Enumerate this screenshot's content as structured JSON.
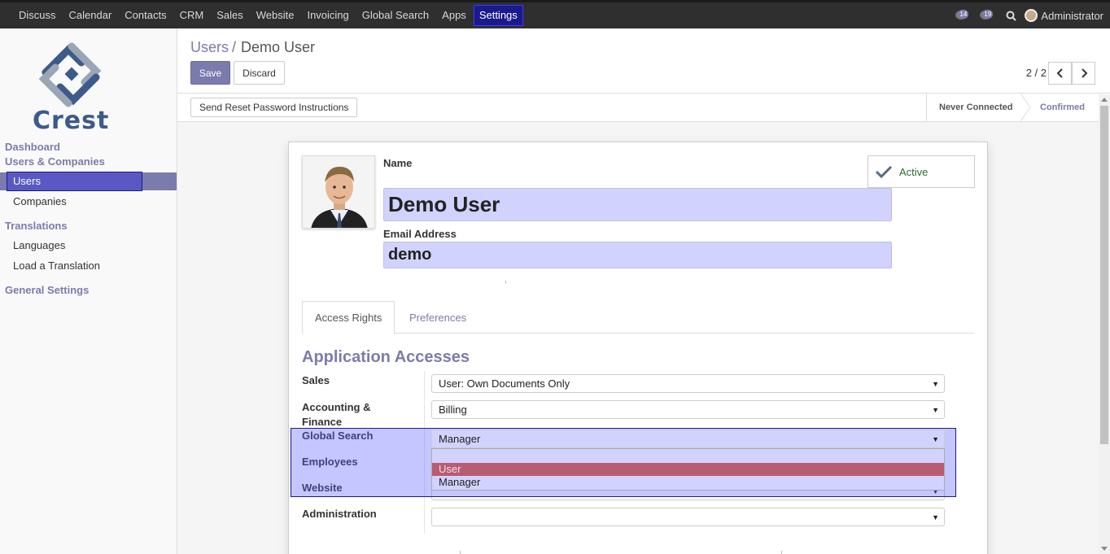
{
  "topbar": {
    "menu": [
      "Discuss",
      "Calendar",
      "Contacts",
      "CRM",
      "Sales",
      "Website",
      "Invoicing",
      "Global Search",
      "Apps",
      "Settings"
    ],
    "active_menu": "Settings",
    "messages_count": "14",
    "activities_count": "19",
    "user": "Administrator"
  },
  "sidebar": {
    "logo_text": "Crest",
    "sections": {
      "dashboard": "Dashboard",
      "users_companies": "Users & Companies",
      "translations": "Translations",
      "general_settings": "General Settings"
    },
    "items": {
      "users": "Users",
      "companies": "Companies",
      "languages": "Languages",
      "load_translation": "Load a Translation"
    }
  },
  "control": {
    "breadcrumb_parent": "Users",
    "breadcrumb_sep": "/",
    "breadcrumb_current": "Demo User",
    "save_label": "Save",
    "discard_label": "Discard",
    "pager": "2 / 2"
  },
  "statusbar": {
    "reset_label": "Send Reset Password Instructions",
    "stage_never": "Never Connected",
    "stage_confirmed": "Confirmed"
  },
  "form": {
    "name_label": "Name",
    "name_value": "Demo User",
    "email_label": "Email Address",
    "email_value": "demo",
    "active_label": "Active",
    "tabs": [
      "Access Rights",
      "Preferences"
    ],
    "section_title": "Application Accesses",
    "fields": [
      {
        "label": "Sales",
        "value": "User: Own Documents Only"
      },
      {
        "label": "Accounting & Finance",
        "value": "Billing"
      },
      {
        "label": "Global Search",
        "value": "Manager"
      },
      {
        "label": "Employees",
        "value": ""
      },
      {
        "label": "Website",
        "value": ""
      },
      {
        "label": "Administration",
        "value": ""
      }
    ],
    "dropdown_options": [
      "",
      "User",
      "Manager"
    ],
    "dropdown_highlighted": "User"
  },
  "colors": {
    "brand": "#7c7bad",
    "topbar": "#2f2f2f",
    "field_bg": "#d2d2ff",
    "highlight_option": "#b85c72"
  }
}
